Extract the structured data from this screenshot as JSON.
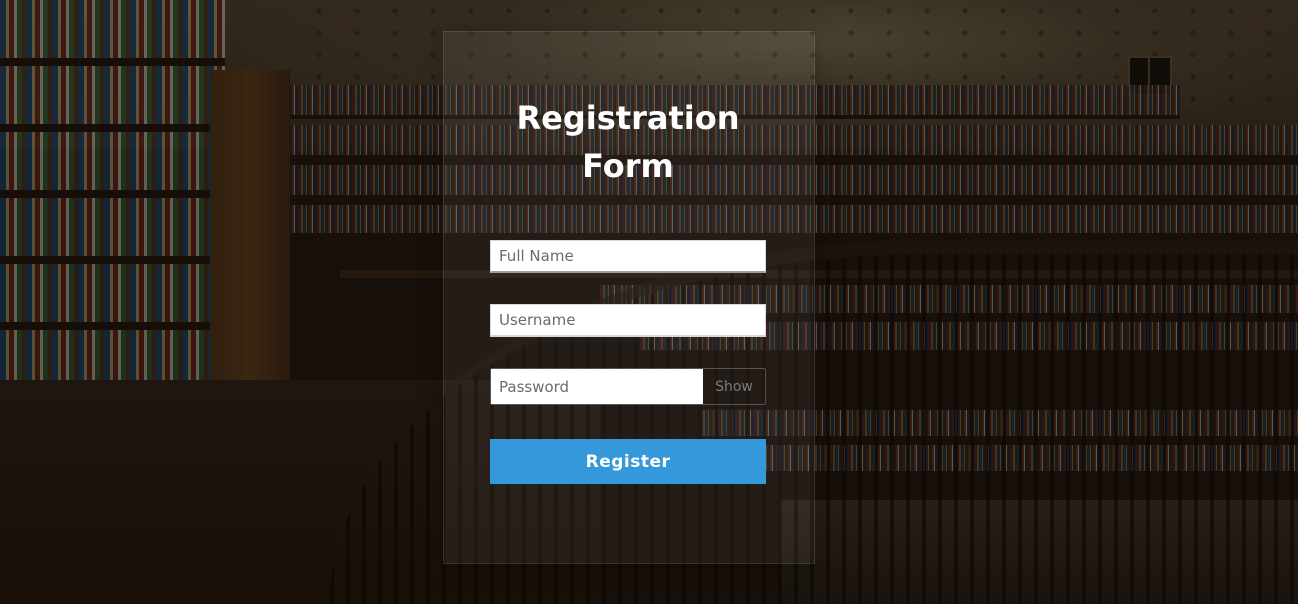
{
  "form": {
    "title_line1": "Registration",
    "title_line2": "Form",
    "fullname_placeholder": "Full Name",
    "fullname_value": "",
    "username_placeholder": "Username",
    "username_value": "",
    "password_placeholder": "Password",
    "password_value": "",
    "show_label": "Show",
    "register_label": "Register"
  },
  "colors": {
    "accent": "#3498db",
    "title": "#ffffff",
    "overlay": "rgba(0,0,0,0.45)"
  },
  "background": {
    "scene": "library-interior"
  }
}
